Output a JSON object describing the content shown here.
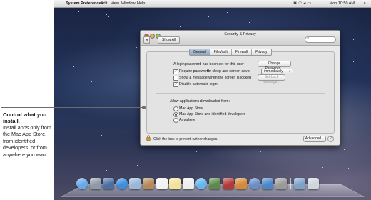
{
  "annotation": {
    "title": "Control what you install.",
    "body": "Install apps only from the Mac App Store, from identified developers, or from anywhere you want."
  },
  "menubar": {
    "apple": "",
    "app": "System Preferences",
    "items": [
      "Edit",
      "View",
      "Window",
      "Help"
    ],
    "clock": "Mon 10:50 AM"
  },
  "window": {
    "title": "Security & Privacy",
    "show_all": "Show All",
    "tabs": [
      "General",
      "FileVault",
      "Firewall",
      "Privacy"
    ],
    "active_tab": "General",
    "general": {
      "password_text": "A login password has been set for this user",
      "change_password_button": "Change Password...",
      "require_password_label": "Require password",
      "require_password_checked": true,
      "require_password_suffix": "for sleep and screen saver",
      "require_password_timing": "immediately",
      "show_message_label": "Show a message when the screen is locked",
      "show_message_checked": false,
      "set_lock_message_button": "Set Lock Message...",
      "disable_autologin_label": "Disable automatic login",
      "disable_autologin_checked": true,
      "allow_apps_heading": "Allow applications downloaded from:",
      "allow_options": [
        "Mac App Store",
        "Mac App Store and identified developers",
        "Anywhere"
      ],
      "allow_selected": "Mac App Store and identified developers"
    },
    "lock_text": "Click the lock to prevent further changes.",
    "advanced_button": "Advanced...",
    "help_button": "?"
  },
  "dock": {
    "icons": [
      {
        "name": "finder-icon",
        "color": "#6aa8e8"
      },
      {
        "name": "launchpad-icon",
        "color": "#8e9aa8"
      },
      {
        "name": "mission-control-icon",
        "color": "#4a6fa0"
      },
      {
        "name": "safari-icon",
        "color": "#3e8edc"
      },
      {
        "name": "mail-icon",
        "color": "#9ab7d6"
      },
      {
        "name": "contacts-icon",
        "color": "#b48a5a"
      },
      {
        "name": "calendar-icon",
        "color": "#f2f2f2"
      },
      {
        "name": "notes-icon",
        "color": "#f3e39a"
      },
      {
        "name": "reminders-icon",
        "color": "#eeeeee"
      },
      {
        "name": "messages-icon",
        "color": "#66b6ee"
      },
      {
        "name": "facetime-icon",
        "color": "#5b8a4a"
      },
      {
        "name": "photo-booth-icon",
        "color": "#b33a3a"
      },
      {
        "name": "iphoto-icon",
        "color": "#d48a3a"
      },
      {
        "name": "itunes-icon",
        "color": "#6a8ec8"
      },
      {
        "name": "app-store-icon",
        "color": "#4a86c8"
      },
      {
        "name": "system-preferences-icon",
        "color": "#9a9a9a"
      },
      {
        "name": "downloads-icon",
        "color": "#7da2c9"
      },
      {
        "name": "trash-icon",
        "color": "#cfd5dc"
      }
    ]
  }
}
